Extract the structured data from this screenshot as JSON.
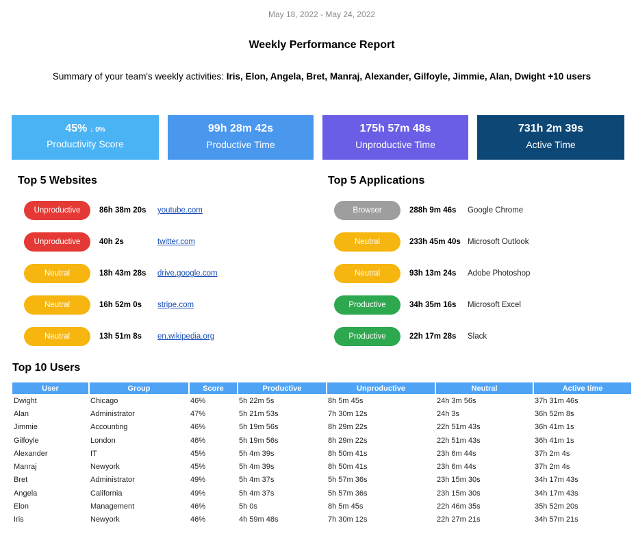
{
  "header": {
    "date_range": "May 18, 2022 - May 24, 2022",
    "title": "Weekly Performance Report",
    "summary_prefix": "Summary of your team's weekly activities: ",
    "summary_users": "Iris, Elon, Angela, Bret, Manraj, Alexander, Gilfoyle, Jimmie, Alan, Dwight +10 users"
  },
  "cards": [
    {
      "value": "45%",
      "delta": "↓ 0%",
      "label": "Productivity Score",
      "color": "#4ab3f4"
    },
    {
      "value": "99h 28m 42s",
      "label": "Productive Time",
      "color": "#4a97ee"
    },
    {
      "value": "175h 57m 48s",
      "label": "Unproductive Time",
      "color": "#6a5ee6"
    },
    {
      "value": "731h 2m 39s",
      "label": "Active Time",
      "color": "#0d4776"
    }
  ],
  "websites": {
    "title": "Top 5 Websites",
    "items": [
      {
        "status": "Unproductive",
        "duration": "86h 38m 20s",
        "site": "youtube.com"
      },
      {
        "status": "Unproductive",
        "duration": "40h 2s",
        "site": "twitter.com"
      },
      {
        "status": "Neutral",
        "duration": "18h 43m 28s",
        "site": "drive.google.com"
      },
      {
        "status": "Neutral",
        "duration": "16h 52m 0s",
        "site": "stripe.com"
      },
      {
        "status": "Neutral",
        "duration": "13h 51m 8s",
        "site": "en.wikipedia.org"
      }
    ]
  },
  "applications": {
    "title": "Top 5 Applications",
    "items": [
      {
        "status": "Browser",
        "duration": "288h 9m 46s",
        "app": "Google Chrome"
      },
      {
        "status": "Neutral",
        "duration": "233h 45m 40s",
        "app": "Microsoft Outlook"
      },
      {
        "status": "Neutral",
        "duration": "93h 13m 24s",
        "app": "Adobe Photoshop"
      },
      {
        "status": "Productive",
        "duration": "34h 35m 16s",
        "app": "Microsoft Excel"
      },
      {
        "status": "Productive",
        "duration": "22h 17m 28s",
        "app": "Slack"
      }
    ]
  },
  "users": {
    "title": "Top 10 Users",
    "columns": [
      "User",
      "Group",
      "Score",
      "Productive",
      "Unproductive",
      "Neutral",
      "Active time"
    ],
    "rows": [
      [
        "Dwight",
        "Chicago",
        "46%",
        "5h 22m 5s",
        "8h 5m 45s",
        "24h 3m 56s",
        "37h 31m 46s"
      ],
      [
        "Alan",
        "Administrator",
        "47%",
        "5h 21m 53s",
        "7h 30m 12s",
        "24h 3s",
        "36h 52m 8s"
      ],
      [
        "Jimmie",
        "Accounting",
        "46%",
        "5h 19m 56s",
        "8h 29m 22s",
        "22h 51m 43s",
        "36h 41m 1s"
      ],
      [
        "Gilfoyle",
        "London",
        "46%",
        "5h 19m 56s",
        "8h 29m 22s",
        "22h 51m 43s",
        "36h 41m 1s"
      ],
      [
        "Alexander",
        "IT",
        "45%",
        "5h 4m 39s",
        "8h 50m 41s",
        "23h 6m 44s",
        "37h 2m 4s"
      ],
      [
        "Manraj",
        "Newyork",
        "45%",
        "5h 4m 39s",
        "8h 50m 41s",
        "23h 6m 44s",
        "37h 2m 4s"
      ],
      [
        "Bret",
        "Administrator",
        "49%",
        "5h 4m 37s",
        "5h 57m 36s",
        "23h 15m 30s",
        "34h 17m 43s"
      ],
      [
        "Angela",
        "California",
        "49%",
        "5h 4m 37s",
        "5h 57m 36s",
        "23h 15m 30s",
        "34h 17m 43s"
      ],
      [
        "Elon",
        "Management",
        "46%",
        "5h 0s",
        "8h 5m 45s",
        "22h 46m 35s",
        "35h 52m 20s"
      ],
      [
        "Iris",
        "Newyork",
        "46%",
        "4h 59m 48s",
        "7h 30m 12s",
        "22h 27m 21s",
        "34h 57m 21s"
      ]
    ]
  }
}
